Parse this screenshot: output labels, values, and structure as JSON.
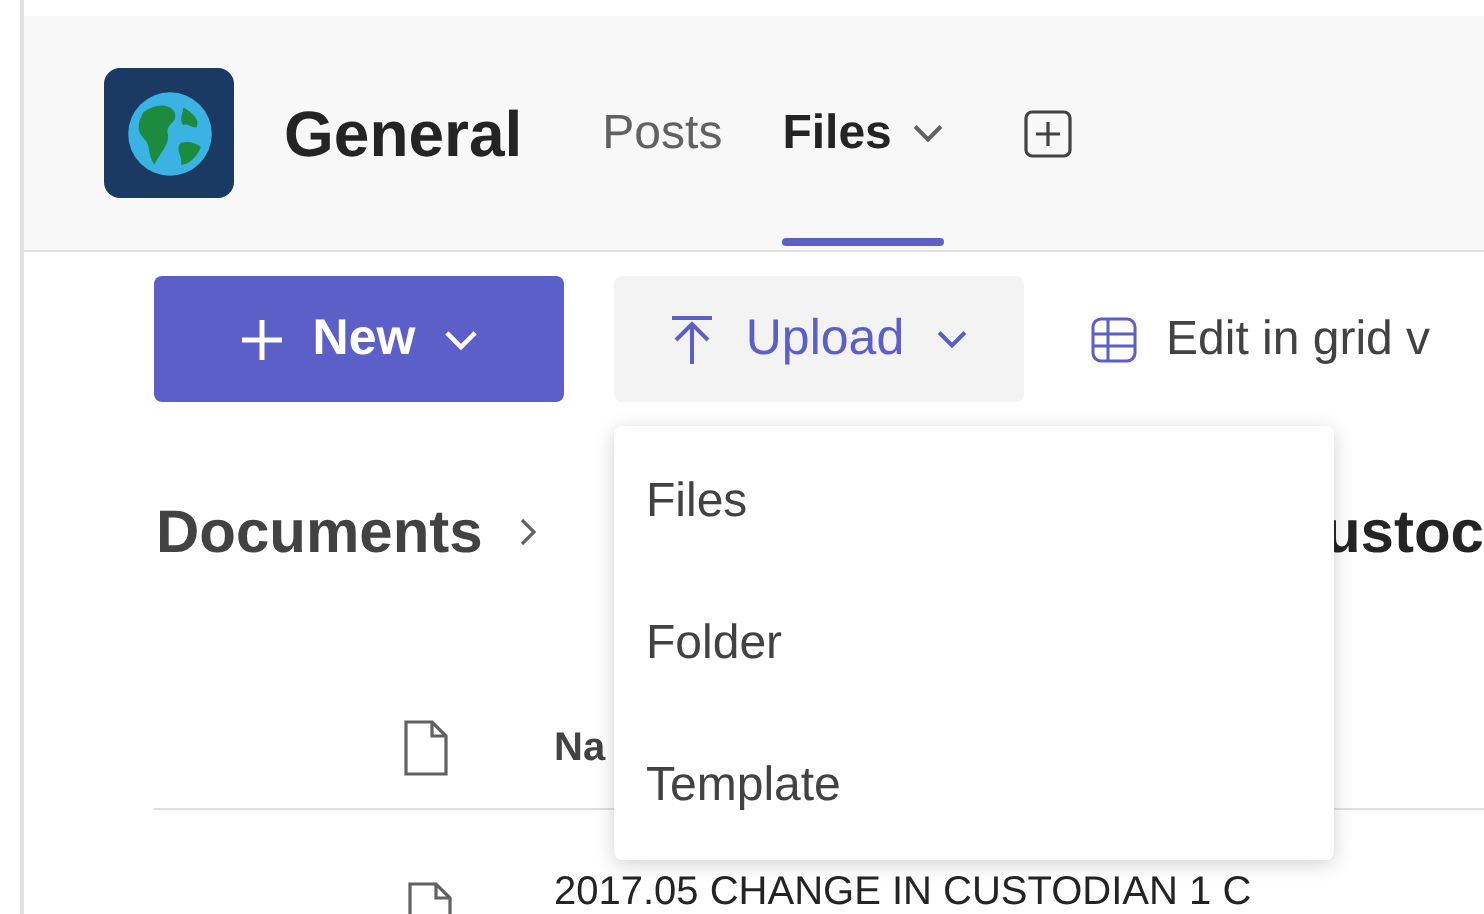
{
  "header": {
    "title": "General",
    "tabs": [
      {
        "label": "Posts",
        "selected": false,
        "dropdown": false
      },
      {
        "label": "Files",
        "selected": true,
        "dropdown": true
      }
    ]
  },
  "toolbar": {
    "new_button": "New",
    "upload_button": "Upload",
    "edit_grid": "Edit in grid v"
  },
  "breadcrumb": {
    "root": "Documents",
    "current": "ustoc"
  },
  "upload_menu": {
    "items": [
      "Files",
      "Folder",
      "Template"
    ]
  },
  "table": {
    "columns": [
      "Na"
    ],
    "rows": [
      {
        "name": "2017.05 CHANGE IN CUSTODIAN 1 C"
      }
    ]
  }
}
